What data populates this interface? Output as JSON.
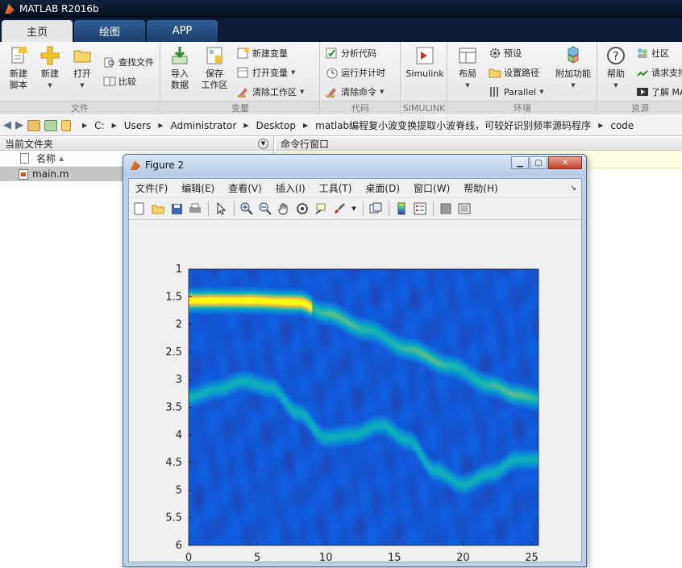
{
  "window": {
    "title": "MATLAB R2016b"
  },
  "tabs": [
    {
      "label": "主页",
      "active": true
    },
    {
      "label": "绘图",
      "active": false
    },
    {
      "label": "APP",
      "active": false
    }
  ],
  "ribbon": {
    "file": {
      "label": "文件",
      "new_script": "新建\n脚本",
      "new": "新建",
      "open": "打开",
      "find_files": "查找文件",
      "compare": "比较"
    },
    "variable": {
      "label": "变量",
      "import": "导入\n数据",
      "save": "保存\n工作区",
      "new_var": "新建变量",
      "open_var": "打开变量",
      "clear_ws": "清除工作区"
    },
    "code": {
      "label": "代码",
      "analyze": "分析代码",
      "run_time": "运行并计时",
      "clear_cmd": "清除命令"
    },
    "simulink": {
      "label": "SIMULINK",
      "btn": "Simulink"
    },
    "env": {
      "label": "环境",
      "layout": "布局",
      "prefs": "预设",
      "set_path": "设置路径",
      "parallel": "Parallel",
      "addons": "附加功能"
    },
    "resources": {
      "label": "资源",
      "help": "帮助",
      "community": "社区",
      "request": "请求支持",
      "learn": "了解 MATLAB"
    }
  },
  "address": {
    "path": [
      "C:",
      "Users",
      "Administrator",
      "Desktop",
      "matlab编程复小波变换提取小波脊线，可较好识别频率源码程序",
      "code"
    ]
  },
  "current_folder": {
    "title": "当前文件夹",
    "col_name": "名称",
    "files": [
      "main.m"
    ]
  },
  "command_window": {
    "title": "命令行窗口"
  },
  "figure": {
    "title": "Figure 2",
    "menu": [
      "文件(F)",
      "编辑(E)",
      "查看(V)",
      "插入(I)",
      "工具(T)",
      "桌面(D)",
      "窗口(W)",
      "帮助(H)"
    ]
  },
  "chart_data": {
    "type": "heatmap",
    "x_ticks": [
      0,
      5,
      10,
      15,
      20,
      25
    ],
    "y_ticks": [
      1,
      1.5,
      2,
      2.5,
      3,
      3.5,
      4,
      4.5,
      5,
      5.5,
      6
    ],
    "xlim": [
      0,
      25.5
    ],
    "ylim": [
      1,
      6
    ],
    "y_reversed": true,
    "colormap": "parula",
    "ridges": [
      {
        "points": [
          [
            0,
            1.57
          ],
          [
            4,
            1.57
          ],
          [
            8,
            1.6
          ],
          [
            10,
            1.8
          ],
          [
            13,
            2.1
          ],
          [
            16,
            2.45
          ],
          [
            19,
            2.75
          ],
          [
            22,
            3.1
          ],
          [
            24,
            3.28
          ],
          [
            25.5,
            3.35
          ]
        ],
        "peak": 1.0,
        "width": 0.18
      },
      {
        "points": [
          [
            0,
            3.32
          ],
          [
            2,
            3.18
          ],
          [
            4,
            3.03
          ],
          [
            6,
            3.15
          ],
          [
            8,
            3.6
          ],
          [
            10,
            4.05
          ],
          [
            12,
            4.0
          ],
          [
            14,
            3.82
          ],
          [
            16,
            4.1
          ],
          [
            18,
            4.65
          ],
          [
            20,
            4.9
          ],
          [
            22,
            4.7
          ],
          [
            24,
            4.45
          ],
          [
            25.5,
            4.45
          ]
        ],
        "peak": 0.55,
        "width": 0.17
      }
    ]
  }
}
